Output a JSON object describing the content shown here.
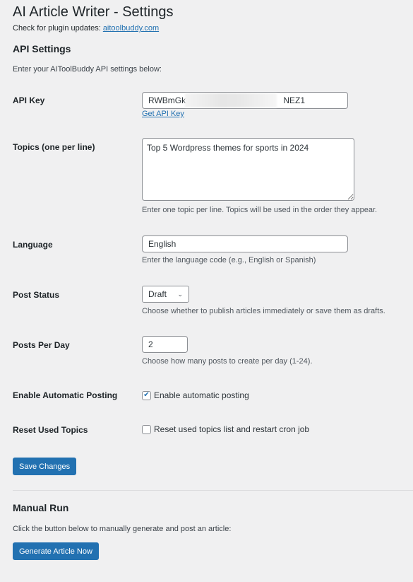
{
  "page": {
    "title": "AI Article Writer - Settings",
    "update_note_prefix": "Check for plugin updates: ",
    "update_link": "aitoolbuddy.com"
  },
  "api_settings": {
    "heading": "API Settings",
    "intro": "Enter your AIToolBuddy API settings below:",
    "fields": {
      "api_key": {
        "label": "API Key",
        "value_visible_start": "RWBmGk",
        "value_visible_end": "NEZ1",
        "link": "Get API Key"
      },
      "topics": {
        "label": "Topics (one per line)",
        "value": "Top 5 Wordpress themes for sports in 2024",
        "description": "Enter one topic per line. Topics will be used in the order they appear."
      },
      "language": {
        "label": "Language",
        "value": "English",
        "description": "Enter the language code (e.g., English or Spanish)"
      },
      "post_status": {
        "label": "Post Status",
        "selected": "Draft",
        "description": "Choose whether to publish articles immediately or save them as drafts."
      },
      "posts_per_day": {
        "label": "Posts Per Day",
        "value": "2",
        "description": "Choose how many posts to create per day (1-24)."
      },
      "enable_auto": {
        "label": "Enable Automatic Posting",
        "checkbox_label": "Enable automatic posting",
        "checked": true
      },
      "reset_topics": {
        "label": "Reset Used Topics",
        "checkbox_label": "Reset used topics list and restart cron job",
        "checked": false
      }
    },
    "save_button": "Save Changes"
  },
  "manual_run": {
    "heading": "Manual Run",
    "intro": "Click the button below to manually generate and post an article:",
    "button": "Generate Article Now"
  },
  "colors": {
    "accent": "#2271b1",
    "background": "#f0f0f1"
  }
}
